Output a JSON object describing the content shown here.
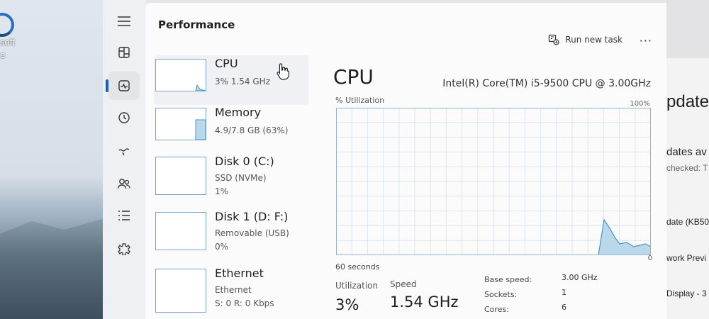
{
  "desktop": {
    "icon_label_line1": "soft",
    "icon_label_line2": "e"
  },
  "window": {
    "title": "Performance",
    "run_new_task": "Run new task",
    "more": "···"
  },
  "nav": [
    "menu-icon",
    "processes-icon",
    "performance-icon",
    "app-history-icon",
    "startup-apps-icon",
    "users-icon",
    "details-icon",
    "services-icon"
  ],
  "devices": [
    {
      "name": "CPU",
      "line1": "3%  1.54 GHz",
      "line2": "",
      "selected": true
    },
    {
      "name": "Memory",
      "line1": "4.9/7.8 GB (63%)",
      "line2": "",
      "selected": false
    },
    {
      "name": "Disk 0 (C:)",
      "line1": "SSD (NVMe)",
      "line2": "1%",
      "selected": false
    },
    {
      "name": "Disk 1 (D: F:)",
      "line1": "Removable (USB)",
      "line2": "0%",
      "selected": false
    },
    {
      "name": "Ethernet",
      "line1": "Ethernet",
      "line2": "S: 0  R: 0 Kbps",
      "selected": false
    }
  ],
  "detail": {
    "heading": "CPU",
    "model": "Intel(R) Core(TM) i5-9500 CPU @ 3.00GHz",
    "util_label": "% Utilization",
    "max_label": "100%",
    "time_label": "60 seconds",
    "min_label": "0",
    "utilization_label": "Utilization",
    "utilization_value": "3%",
    "speed_label": "Speed",
    "speed_value": "1.54 GHz",
    "specs": [
      {
        "k": "Base speed:",
        "v": "3.00 GHz"
      },
      {
        "k": "Sockets:",
        "v": "1"
      },
      {
        "k": "Cores:",
        "v": "6"
      }
    ]
  },
  "settings_window": {
    "title": "pdate",
    "line1": "dates av",
    "line2": "checked: T",
    "item1": "date (KB50",
    "item2": "work Previ",
    "item3": "Display - 3"
  },
  "colors": {
    "accent": "#1c5fb8",
    "graph_line": "#4a93c9",
    "graph_fill": "#b9d8ea",
    "grid": "#dde6ee"
  }
}
